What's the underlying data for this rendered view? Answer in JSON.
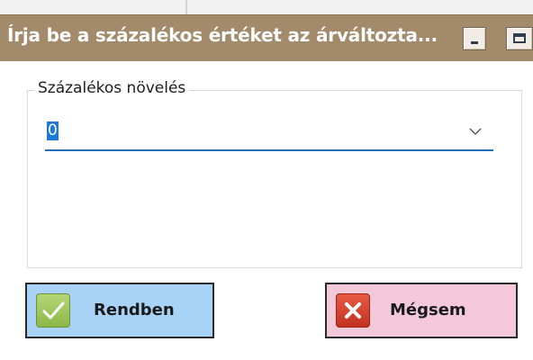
{
  "window": {
    "title": "Írja be a százalékos értéket az árváltozta..."
  },
  "group": {
    "legend": "Százalékos növelés"
  },
  "combo": {
    "value": "0"
  },
  "buttons": {
    "ok_label": "Rendben",
    "cancel_label": "Mégsem"
  },
  "colors": {
    "titlebar": "#a38a6a",
    "ok_button_bg": "#a9d2f7",
    "cancel_button_bg": "#f3c9d9",
    "selection": "#1e78d7",
    "focus_underline": "#1f6fbd"
  },
  "icons": {
    "minimize": "minimize-icon",
    "maximize": "maximize-icon",
    "dropdown": "chevron-down-icon",
    "ok": "checkmark-icon",
    "cancel": "x-icon"
  }
}
